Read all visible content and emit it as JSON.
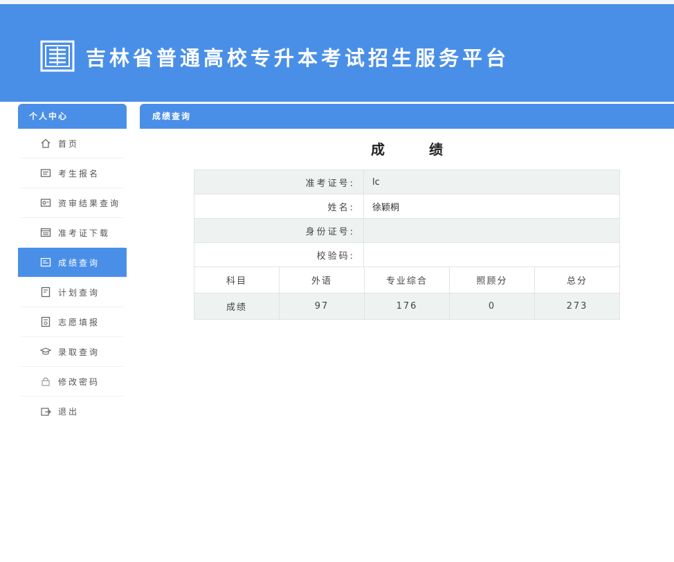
{
  "header": {
    "title": "吉林省普通高校专升本考试招生服务平台"
  },
  "sidebar": {
    "title": "个人中心",
    "items": [
      {
        "label": "首页",
        "icon": "home-icon"
      },
      {
        "label": "考生报名",
        "icon": "register-icon"
      },
      {
        "label": "资审结果查询",
        "icon": "review-icon"
      },
      {
        "label": "准考证下载",
        "icon": "ticket-icon"
      },
      {
        "label": "成绩查询",
        "icon": "score-icon"
      },
      {
        "label": "计划查询",
        "icon": "plan-icon"
      },
      {
        "label": "志愿填报",
        "icon": "form-icon"
      },
      {
        "label": "录取查询",
        "icon": "graduation-cap-icon"
      },
      {
        "label": "修改密码",
        "icon": "lock-icon"
      },
      {
        "label": "退出",
        "icon": "logout-icon"
      }
    ],
    "active_index": 4
  },
  "content": {
    "breadcrumb": "成绩查询",
    "title": "成绩",
    "info": {
      "exam_id_label": "准考证号:",
      "exam_id_value": "lc",
      "name_label": "姓名:",
      "name_value": "徐颖桐",
      "id_card_label": "身份证号:",
      "id_card_value": "",
      "verify_label": "校验码:",
      "verify_value": ""
    },
    "scores": {
      "headers": [
        "科目",
        "外语",
        "专业综合",
        "照顾分",
        "总分"
      ],
      "row": [
        "成绩",
        "97",
        "176",
        "0",
        "273"
      ]
    }
  },
  "colors": {
    "brand": "#4a8fe7",
    "row_shade": "#eef2f1"
  }
}
